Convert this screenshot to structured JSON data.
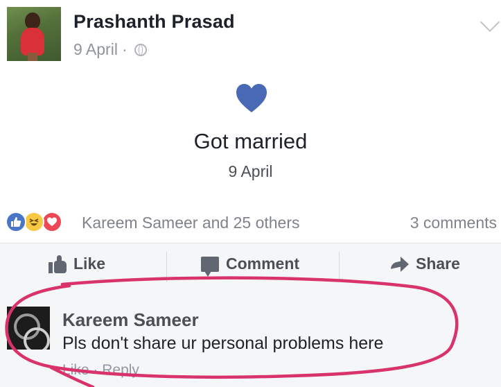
{
  "post": {
    "author": "Prashanth Prasad",
    "date": "9 April",
    "separator": "·",
    "icons": {
      "privacy": "globe-icon",
      "menu": "chevron-down-icon"
    }
  },
  "life_event": {
    "icon": "heart-icon",
    "title": "Got married",
    "date": "9 April"
  },
  "reactions": {
    "types": [
      "like",
      "haha",
      "love"
    ],
    "summary": "Kareem Sameer and 25 others",
    "comments_count": "3 comments"
  },
  "actions": {
    "like": "Like",
    "comment": "Comment",
    "share": "Share"
  },
  "comment": {
    "author": "Kareem Sameer",
    "text": "Pls don't share ur personal problems here",
    "like_link": "Like",
    "separator": "·",
    "reply_link": "Reply"
  },
  "colors": {
    "heart": "#4a69b5",
    "highlight": "#d8336b",
    "action_bar_bg": "#f5f6f7"
  }
}
